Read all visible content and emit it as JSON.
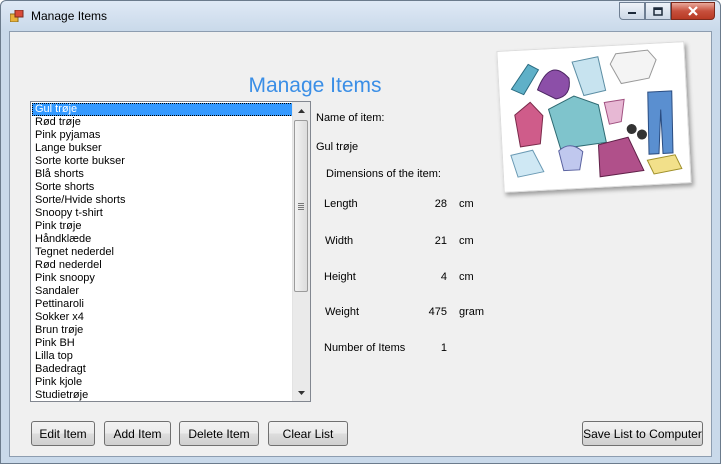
{
  "window": {
    "title": "Manage Items",
    "icon": "app-icon"
  },
  "heading": "Manage Items",
  "items": [
    "Gul trøje",
    "Rød trøje",
    "Pink pyjamas",
    "Lange bukser",
    "Sorte korte bukser",
    "Blå shorts",
    "Sorte shorts",
    "Sorte/Hvide shorts",
    "Snoopy t-shirt",
    "Pink trøje",
    "Håndklæde",
    "Tegnet nederdel",
    "Rød nederdel",
    "Pink snoopy",
    "Sandaler",
    "Pettinaroli",
    "Sokker x4",
    "Brun trøje",
    "Pink BH",
    "Lilla top",
    "Badedragt",
    "Pink kjole",
    "Studietrøje"
  ],
  "selected_index": 0,
  "details": {
    "name_label": "Name of item:",
    "name_value": "Gul trøje",
    "dimensions_label": "Dimensions of the item:",
    "length_label": "Length",
    "length_value": "28",
    "length_unit": "cm",
    "width_label": "Width",
    "width_value": "21",
    "width_unit": "cm",
    "height_label": "Height",
    "height_value": "4",
    "height_unit": "cm",
    "weight_label": "Weight",
    "weight_value": "475",
    "weight_unit": "gram",
    "count_label": "Number of Items",
    "count_value": "1"
  },
  "buttons": {
    "edit": "Edit Item",
    "add": "Add Item",
    "delete": "Delete Item",
    "clear": "Clear List",
    "save": "Save List to Computer"
  },
  "colors": {
    "heading": "#3a8ee6",
    "selection": "#3399ff",
    "close_button": "#c7503d"
  }
}
